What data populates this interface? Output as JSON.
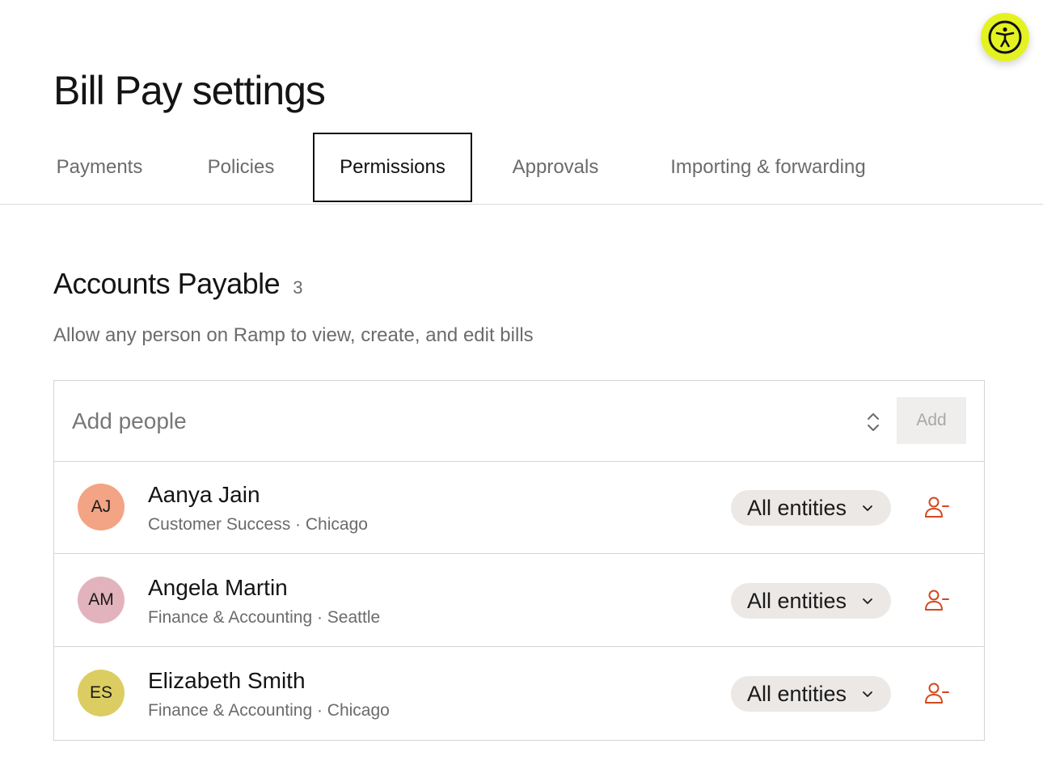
{
  "page": {
    "title": "Bill Pay settings"
  },
  "tabs": [
    {
      "label": "Payments"
    },
    {
      "label": "Policies"
    },
    {
      "label": "Permissions",
      "active": true
    },
    {
      "label": "Approvals"
    },
    {
      "label": "Importing & forwarding"
    }
  ],
  "section": {
    "title": "Accounts Payable",
    "count": "3",
    "description": "Allow any person on Ramp to view, create, and edit bills"
  },
  "add_people": {
    "placeholder": "Add people",
    "button_label": "Add"
  },
  "people": [
    {
      "initials": "AJ",
      "name": "Aanya Jain",
      "meta": "Customer Success · Chicago",
      "entities": "All entities",
      "avatar_color": "#f2a484"
    },
    {
      "initials": "AM",
      "name": "Angela Martin",
      "meta": "Finance & Accounting · Seattle",
      "entities": "All entities",
      "avatar_color": "#e2b3bd"
    },
    {
      "initials": "ES",
      "name": "Elizabeth Smith",
      "meta": "Finance & Accounting · Chicago",
      "entities": "All entities",
      "avatar_color": "#dccd62"
    }
  ],
  "icons": {
    "accessibility": "accessibility-icon",
    "updown": "updown-chevron-icon",
    "chevron": "chevron-down-icon",
    "remove_user": "remove-user-icon"
  },
  "colors": {
    "accent": "#e4f222",
    "remove_icon": "#d2491d"
  }
}
